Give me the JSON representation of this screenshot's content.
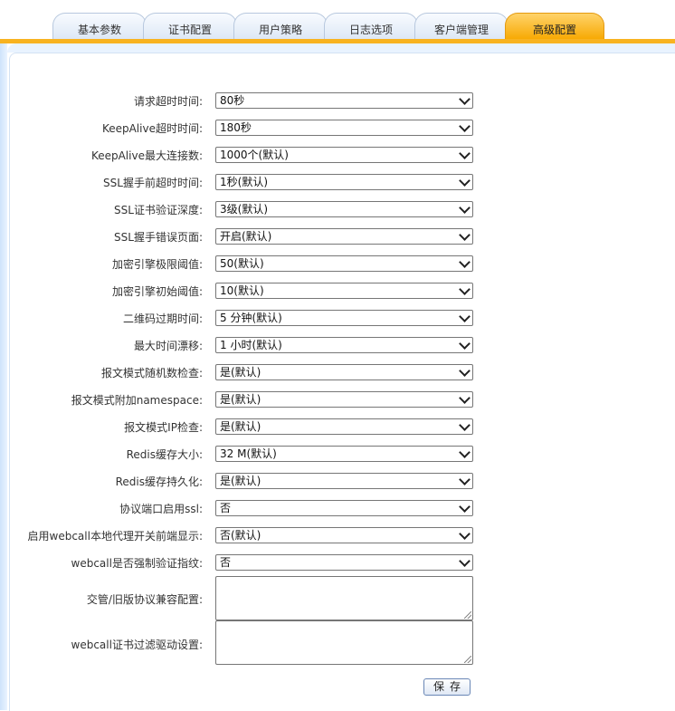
{
  "tabs": [
    {
      "label": "基本参数",
      "active": false
    },
    {
      "label": "证书配置",
      "active": false
    },
    {
      "label": "用户策略",
      "active": false
    },
    {
      "label": "日志选项",
      "active": false
    },
    {
      "label": "客户端管理",
      "active": false
    },
    {
      "label": "高级配置",
      "active": true
    }
  ],
  "settings": [
    {
      "label": "请求超时时间:",
      "value": "80秒"
    },
    {
      "label": "KeepAlive超时时间:",
      "value": "180秒"
    },
    {
      "label": "KeepAlive最大连接数:",
      "value": "1000个(默认)"
    },
    {
      "label": "SSL握手前超时时间:",
      "value": "1秒(默认)"
    },
    {
      "label": "SSL证书验证深度:",
      "value": "3级(默认)"
    },
    {
      "label": "SSL握手错误页面:",
      "value": "开启(默认)"
    },
    {
      "label": "加密引擎极限阈值:",
      "value": "50(默认)"
    },
    {
      "label": "加密引擎初始阈值:",
      "value": "10(默认)"
    },
    {
      "label": "二维码过期时间:",
      "value": "5 分钟(默认)"
    },
    {
      "label": "最大时间漂移:",
      "value": "1 小时(默认)"
    },
    {
      "label": "报文模式随机数检查:",
      "value": "是(默认)"
    },
    {
      "label": "报文模式附加namespace:",
      "value": "是(默认)"
    },
    {
      "label": "报文模式IP检查:",
      "value": "是(默认)"
    },
    {
      "label": "Redis缓存大小:",
      "value": "32 M(默认)"
    },
    {
      "label": "Redis缓存持久化:",
      "value": "是(默认)"
    },
    {
      "label": "协议端口启用ssl:",
      "value": "否"
    },
    {
      "label": "启用webcall本地代理开关前端显示:",
      "value": "否(默认)"
    },
    {
      "label": "webcall是否强制验证指纹:",
      "value": "否"
    }
  ],
  "textareas": [
    {
      "label": "交管/旧版协议兼容配置:",
      "value": ""
    },
    {
      "label": "webcall证书过滤驱动设置:",
      "value": ""
    }
  ],
  "save_label": "保存",
  "colors": {
    "active_tab": "#f7a800",
    "frame": "#e9f3ff",
    "accent_strip": "#f8b321"
  }
}
